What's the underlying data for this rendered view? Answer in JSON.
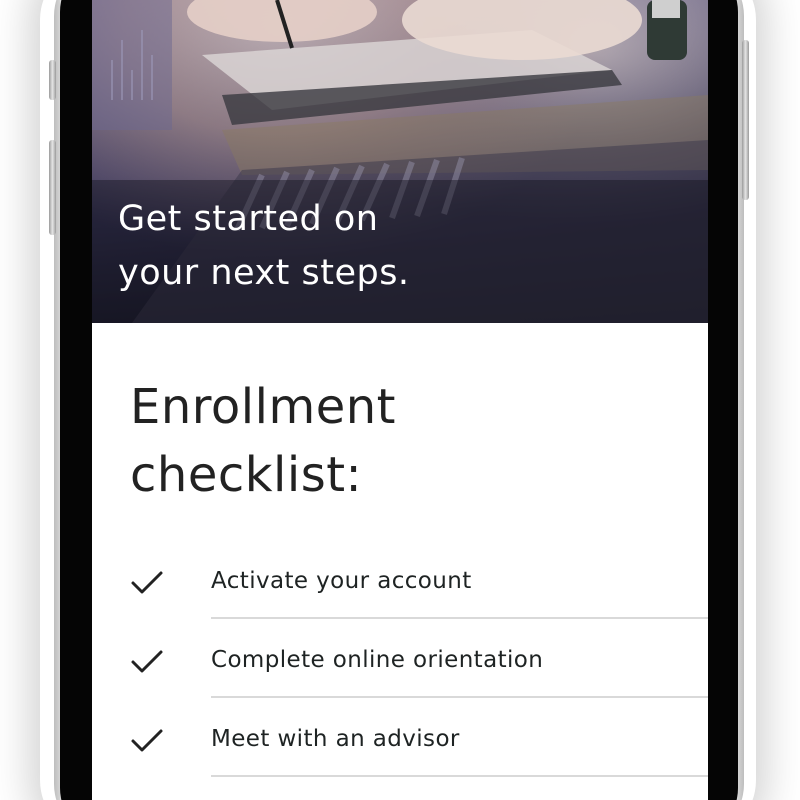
{
  "hero": {
    "title": "Get started on\nyour next steps."
  },
  "checklist": {
    "title": "Enrollment\nchecklist:",
    "items": [
      {
        "label": "Activate your account",
        "checked": true,
        "icon": "checkmark-icon"
      },
      {
        "label": "Complete online orientation",
        "checked": true,
        "icon": "checkmark-icon"
      },
      {
        "label": "Meet with an advisor",
        "checked": true,
        "icon": "checkmark-icon"
      }
    ]
  },
  "colors": {
    "hero_overlay": "#2c2a44",
    "text_dark": "#222222",
    "divider": "#d9d9d9",
    "phone_frame": "#050505"
  }
}
